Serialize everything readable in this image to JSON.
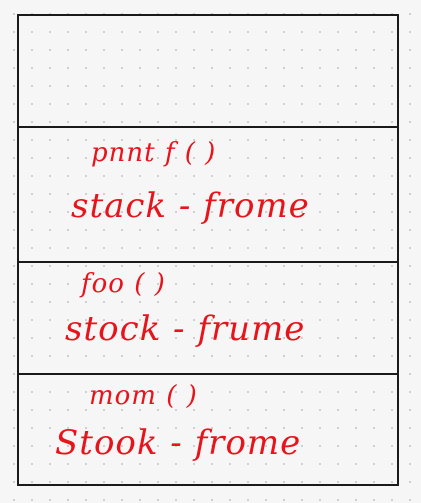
{
  "frames": [
    {
      "function": "pnnt f ( )",
      "label": "stack - frome"
    },
    {
      "function": "foo ( )",
      "label": "stock - frume"
    },
    {
      "function": "mom ( )",
      "label": "Stook - frome"
    }
  ],
  "colors": {
    "ink": "#e8141b",
    "outline": "#1a1a1a",
    "paper": "#f6f6f6",
    "dots": "#c9c9c9"
  }
}
